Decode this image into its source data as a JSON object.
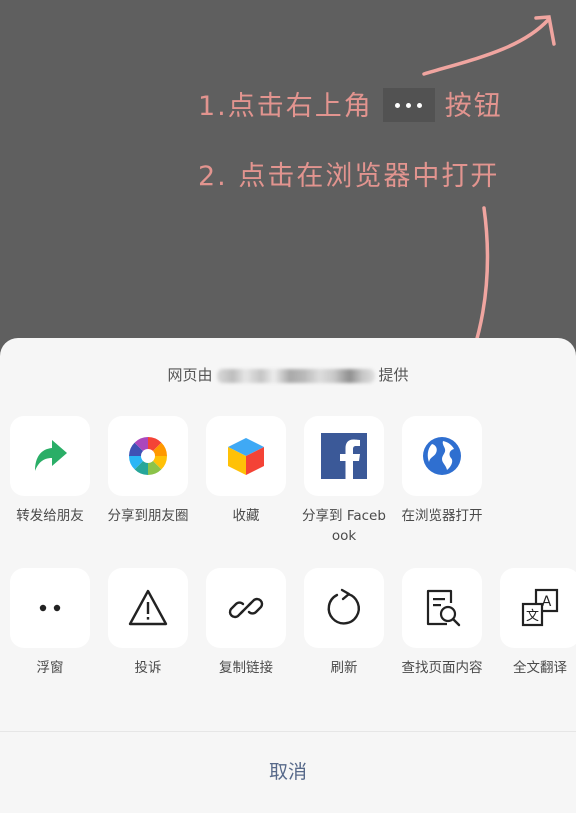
{
  "instructions": {
    "step1_before": "1.点击右上角",
    "step1_after": "按钮",
    "step2": "2. 点击在浏览器中打开"
  },
  "sheet": {
    "provider_prefix": "网页由",
    "provider_suffix": "提供",
    "row1": [
      {
        "label": "转发给朋友",
        "icon": "forward-arrow-icon"
      },
      {
        "label": "分享到朋友圈",
        "icon": "moments-camera-icon"
      },
      {
        "label": "收藏",
        "icon": "favorite-cube-icon"
      },
      {
        "label": "分享到 Facebook",
        "icon": "facebook-icon"
      },
      {
        "label": "在浏览器打开",
        "icon": "globe-icon"
      }
    ],
    "row2": [
      {
        "label": "浮窗",
        "icon": "float-window-icon"
      },
      {
        "label": "投诉",
        "icon": "warning-icon"
      },
      {
        "label": "复制链接",
        "icon": "link-icon"
      },
      {
        "label": "刷新",
        "icon": "refresh-icon"
      },
      {
        "label": "查找页面内容",
        "icon": "search-page-icon"
      },
      {
        "label": "全文翻译",
        "icon": "translate-icon"
      }
    ],
    "cancel": "取消"
  },
  "colors": {
    "annotation": "#e2948f",
    "cancel_text": "#57698a",
    "forward_green": "#2aae67",
    "facebook_blue": "#3b5998",
    "globe_blue": "#2f6fd0"
  }
}
